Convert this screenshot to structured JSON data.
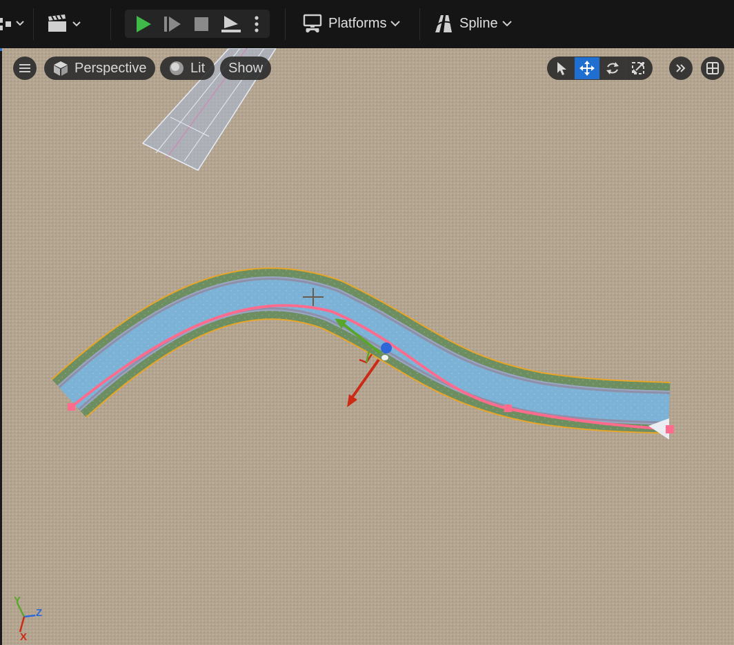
{
  "toolbar": {
    "platforms_label": "Platforms",
    "spline_label": "Spline"
  },
  "viewport": {
    "perspective_label": "Perspective",
    "lit_label": "Lit",
    "show_label": "Show",
    "axis": {
      "z": "Z",
      "x": "X",
      "y": "Y"
    }
  },
  "colors": {
    "accent": "#1f6fd0",
    "play_green": "#3fb948",
    "ground": "#b4a590",
    "road_water": "#7cb2d5",
    "grass": "#6c8e60",
    "spline": "#ff6b8c",
    "gizmo_x": "#cc2a14",
    "gizmo_y": "#5aa62a",
    "gizmo_z": "#2d67d8"
  }
}
